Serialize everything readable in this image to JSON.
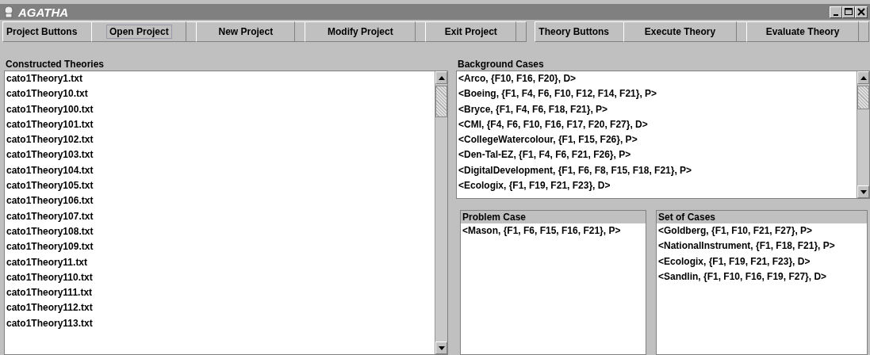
{
  "window": {
    "title": "AGATHA"
  },
  "toolbar": {
    "groups": [
      {
        "label": "Project Buttons",
        "buttons": [
          {
            "label": "Open Project",
            "focused": true
          },
          {
            "label": "New Project",
            "focused": false
          },
          {
            "label": "Modify Project",
            "focused": false
          },
          {
            "label": "Exit Project",
            "focused": false
          }
        ]
      },
      {
        "label": "Theory Buttons",
        "buttons": [
          {
            "label": "Execute Theory",
            "focused": false
          },
          {
            "label": "Evaluate Theory",
            "focused": false
          }
        ]
      }
    ]
  },
  "constructed_theories": {
    "title": "Constructed Theories",
    "items": [
      "cato1Theory1.txt",
      "cato1Theory10.txt",
      "cato1Theory100.txt",
      "cato1Theory101.txt",
      "cato1Theory102.txt",
      "cato1Theory103.txt",
      "cato1Theory104.txt",
      "cato1Theory105.txt",
      "cato1Theory106.txt",
      "cato1Theory107.txt",
      "cato1Theory108.txt",
      "cato1Theory109.txt",
      "cato1Theory11.txt",
      "cato1Theory110.txt",
      "cato1Theory111.txt",
      "cato1Theory112.txt",
      "cato1Theory113.txt"
    ]
  },
  "background_cases": {
    "title": "Background Cases",
    "items": [
      "<Arco, {F10, F16, F20}, D>",
      "<Boeing, {F1, F4, F6, F10, F12, F14, F21}, P>",
      "<Bryce, {F1, F4, F6, F18, F21}, P>",
      "<CMI, {F4, F6, F10, F16, F17, F20, F27}, D>",
      "<CollegeWatercolour, {F1, F15, F26}, P>",
      "<Den-Tal-EZ, {F1, F4, F6, F21, F26}, P>",
      "<DigitalDevelopment, {F1, F6, F8, F15, F18, F21}, P>",
      "<Ecologix, {F1, F19, F21, F23}, D>"
    ]
  },
  "problem_case": {
    "title": "Problem Case",
    "items": [
      "<Mason, {F1, F6, F15, F16, F21}, P>"
    ]
  },
  "set_of_cases": {
    "title": "Set of Cases",
    "items": [
      "<Goldberg, {F1, F10, F21, F27}, P>",
      "<NationalInstrument, {F1, F18, F21}, P>",
      "<Ecologix, {F1, F19, F21, F23}, D>",
      "<Sandlin, {F1, F10, F16, F19, F27}, D>"
    ]
  }
}
